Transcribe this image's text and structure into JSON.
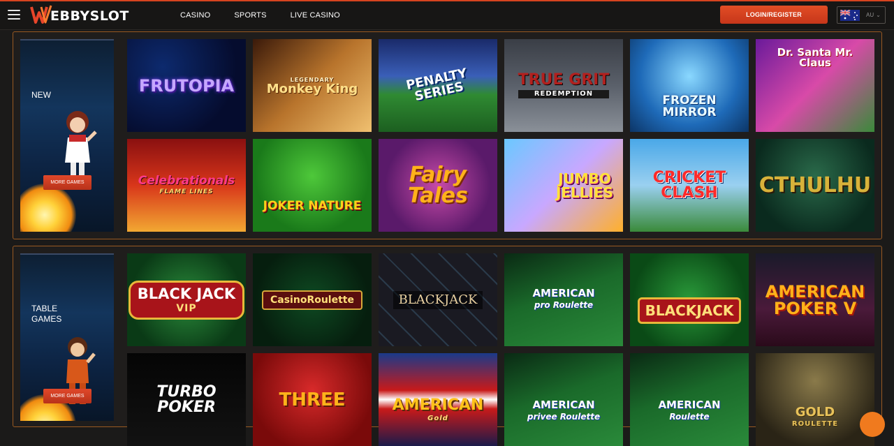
{
  "header": {
    "logo": {
      "text": "EBBYSLOT",
      "mark_letter": "W"
    },
    "nav": [
      {
        "label": "CASINO"
      },
      {
        "label": "SPORTS"
      },
      {
        "label": "LIVE CASINO"
      }
    ],
    "login_label": "LOGIN/REGISTER",
    "language": {
      "code": "AU",
      "flag": "australia-flag-icon"
    }
  },
  "sections": [
    {
      "title": "NEW",
      "more_label": "MORE GAMES",
      "games": [
        {
          "title": "FRUTOPIA",
          "sub": ""
        },
        {
          "title": "Monkey King",
          "sub": "LEGENDARY"
        },
        {
          "title": "PENALTY SERIES",
          "sub": ""
        },
        {
          "title": "TRUE GRIT",
          "sub": "REDEMPTION"
        },
        {
          "title": "FROZEN MIRROR",
          "sub": ""
        },
        {
          "title": "Dr. Santa Mr. Claus",
          "sub": ""
        },
        {
          "title": "Celebrationals",
          "sub": "FLAME LINES"
        },
        {
          "title": "JOKER NATURE",
          "sub": ""
        },
        {
          "title": "Fairy Tales",
          "sub": ""
        },
        {
          "title": "JUMBO JELLIES",
          "sub": ""
        },
        {
          "title": "CRICKET CLASH",
          "sub": ""
        },
        {
          "title": "CTHULHU",
          "sub": ""
        }
      ]
    },
    {
      "title": "TABLE GAMES",
      "more_label": "MORE GAMES",
      "games": [
        {
          "title": "BLACK JACK",
          "sub": "VIP"
        },
        {
          "title": "CasinoRoulette",
          "sub": ""
        },
        {
          "title": "BLACKJACK",
          "sub": ""
        },
        {
          "title": "AMERICAN",
          "sub": "pro Roulette"
        },
        {
          "title": "BLACKJACK",
          "sub": ""
        },
        {
          "title": "AMERICAN POKER V",
          "sub": ""
        },
        {
          "title": "TURBO POKER",
          "sub": ""
        },
        {
          "title": "THREE",
          "sub": ""
        },
        {
          "title": "AMERICAN",
          "sub": "Gold"
        },
        {
          "title": "AMERICAN",
          "sub": "privee Roulette"
        },
        {
          "title": "AMERICAN",
          "sub": "Roulette"
        },
        {
          "title": "GOLD",
          "sub": "ROULETTE"
        }
      ]
    }
  ],
  "colors": {
    "accent": "#d7441f",
    "border": "#9a5a22",
    "background": "#1b1a19"
  }
}
